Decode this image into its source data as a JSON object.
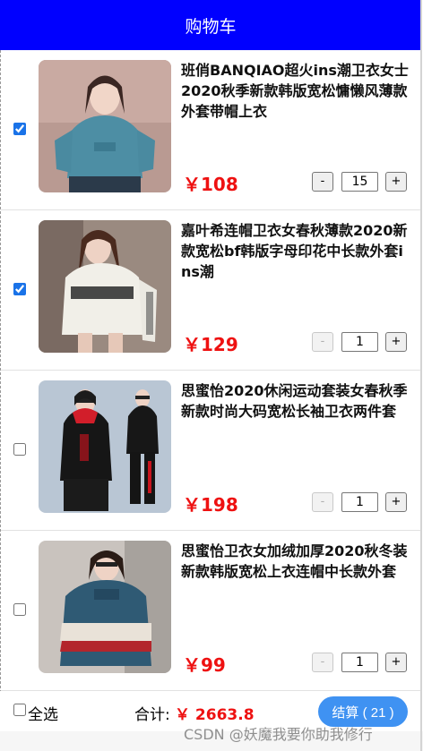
{
  "header": {
    "title": "购物车"
  },
  "items": [
    {
      "title": "班俏BANQIAO超火ins潮卫衣女士2020秋季新款韩版宽松慵懒风薄款外套带帽上衣",
      "price": "￥108",
      "qty": "15",
      "checked": true,
      "minus_disabled": false,
      "minus": "-",
      "plus": "+",
      "image": "teal-hoodie-photo"
    },
    {
      "title": "嘉叶希连帽卫衣女春秋薄款2020新款宽松bf韩版字母印花中长款外套ins潮",
      "price": "￥129",
      "qty": "1",
      "checked": true,
      "minus_disabled": true,
      "minus": "-",
      "plus": "+",
      "image": "white-printed-hoodie-photo"
    },
    {
      "title": "思蜜怡2020休闲运动套装女春秋季新款时尚大码宽松长袖卫衣两件套",
      "price": "￥198",
      "qty": "1",
      "checked": false,
      "minus_disabled": true,
      "minus": "-",
      "plus": "+",
      "image": "black-tracksuit-photo"
    },
    {
      "title": "思蜜怡卫衣女加绒加厚2020秋冬装新款韩版宽松上衣连帽中长款外套",
      "price": "￥99",
      "qty": "1",
      "checked": false,
      "minus_disabled": true,
      "minus": "-",
      "plus": "+",
      "image": "blue-hoodie-photo"
    }
  ],
  "footer": {
    "select_all_label": "全选",
    "total_label": "合计:",
    "total_value": "￥ 2663.8",
    "checkout_label": "结算 ( 21 )"
  },
  "watermark": "CSDN @妖魔我要你助我修行",
  "colors": {
    "header_bg": "#0000ff",
    "price": "#ee1111",
    "checkout_bg": "#3f92f2"
  }
}
